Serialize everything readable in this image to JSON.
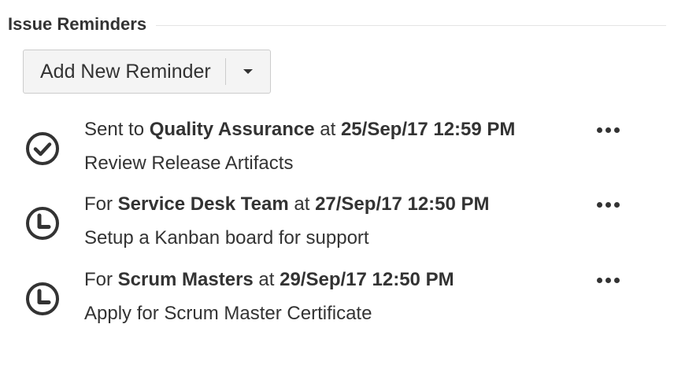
{
  "section": {
    "title": "Issue Reminders"
  },
  "add_button": {
    "label": "Add New Reminder",
    "dropdown_icon": "caret-down-icon"
  },
  "reminders": [
    {
      "status_icon": "check-circle-icon",
      "prefix": "Sent to",
      "group": "Quality Assurance",
      "at": "at",
      "datetime": "25/Sep/17 12:59 PM",
      "title": "Review Release Artifacts",
      "menu_icon": "more-horizontal-icon"
    },
    {
      "status_icon": "clock-icon",
      "prefix": "For",
      "group": "Service Desk Team",
      "at": "at",
      "datetime": "27/Sep/17 12:50 PM",
      "title": "Setup a Kanban board for support",
      "menu_icon": "more-horizontal-icon"
    },
    {
      "status_icon": "clock-icon",
      "prefix": "For",
      "group": "Scrum Masters",
      "at": "at",
      "datetime": "29/Sep/17 12:50 PM",
      "title": "Apply for Scrum Master Certificate",
      "menu_icon": "more-horizontal-icon"
    }
  ],
  "colors": {
    "text": "#333333",
    "button_bg": "#f4f4f4",
    "border": "#cccccc"
  }
}
